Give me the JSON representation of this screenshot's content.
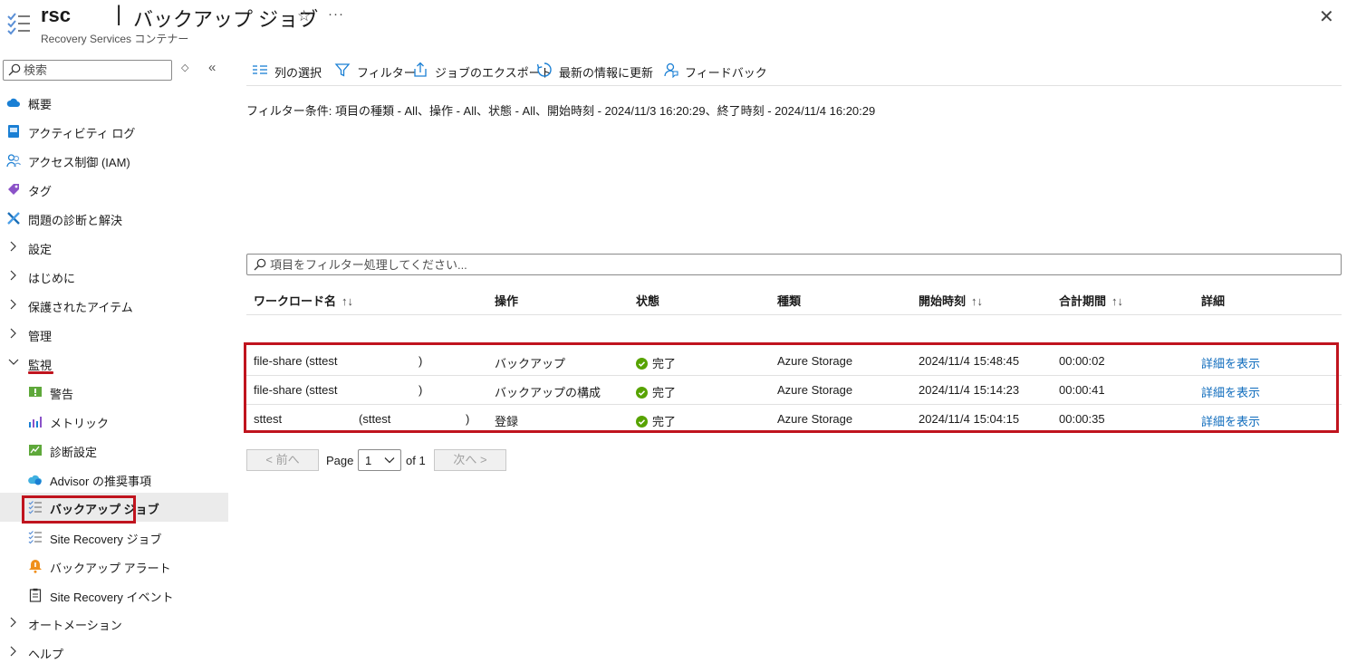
{
  "header": {
    "resource_name": "rsc",
    "separator": "|",
    "page_title": "バックアップ ジョブ",
    "subtitle": "Recovery Services コンテナー",
    "star_icon": "☆",
    "more_icon": "···",
    "close_icon": "✕"
  },
  "sidebar": {
    "search_placeholder": "検索",
    "updown_icon": "◇",
    "collapse_icon": "«",
    "items": [
      {
        "label": "概要"
      },
      {
        "label": "アクティビティ ログ"
      },
      {
        "label": "アクセス制御 (IAM)"
      },
      {
        "label": "タグ"
      },
      {
        "label": "問題の診断と解決"
      },
      {
        "label": "設定"
      },
      {
        "label": "はじめに"
      },
      {
        "label": "保護されたアイテム"
      },
      {
        "label": "管理"
      },
      {
        "label": "監視"
      },
      {
        "label": "警告"
      },
      {
        "label": "メトリック"
      },
      {
        "label": "診断設定"
      },
      {
        "label": "Advisor の推奨事項"
      },
      {
        "label": "バックアップ ジョブ"
      },
      {
        "label": "Site Recovery ジョブ"
      },
      {
        "label": "バックアップ アラート"
      },
      {
        "label": "Site Recovery イベント"
      },
      {
        "label": "オートメーション"
      },
      {
        "label": "ヘルプ"
      }
    ]
  },
  "toolbar": {
    "columns_label": "列の選択",
    "filter_label": "フィルター",
    "export_label": "ジョブのエクスポート",
    "refresh_label": "最新の情報に更新",
    "feedback_label": "フィードバック"
  },
  "filter_condition": "フィルター条件: 項目の種類 - All、操作 - All、状態 - All、開始時刻 - 2024/11/3 16:20:29、終了時刻 - 2024/11/4 16:20:29",
  "filter_placeholder": "項目をフィルター処理してください...",
  "table": {
    "headers": {
      "workload": "ワークロード名",
      "operation": "操作",
      "status": "状態",
      "type": "種類",
      "start_time": "開始時刻",
      "duration": "合計期間",
      "details": "詳細"
    },
    "sort_icon": "↑↓",
    "rows": [
      {
        "workload": "file-share (sttest",
        "workload_paren": ")",
        "operation": "バックアップ",
        "status": "完了",
        "type": "Azure Storage",
        "start_time": "2024/11/4 15:48:45",
        "duration": "00:00:02",
        "details": "詳細を表示"
      },
      {
        "workload": "file-share (sttest",
        "workload_paren": ")",
        "operation": "バックアップの構成",
        "status": "完了",
        "type": "Azure Storage",
        "start_time": "2024/11/4 15:14:23",
        "duration": "00:00:41",
        "details": "詳細を表示"
      },
      {
        "workload": "sttest",
        "workload_extra": "(sttest",
        "workload_paren": ")",
        "operation": "登録",
        "status": "完了",
        "type": "Azure Storage",
        "start_time": "2024/11/4 15:04:15",
        "duration": "00:00:35",
        "details": "詳細を表示"
      }
    ]
  },
  "pager": {
    "prev_label": "< 前へ",
    "page_label": "Page",
    "page_value": "1",
    "of_label": "of 1",
    "next_label": "次へ >"
  },
  "colors": {
    "highlight_red": "#c0141e",
    "link_blue": "#0f6cbd",
    "success_green": "#57a300"
  }
}
